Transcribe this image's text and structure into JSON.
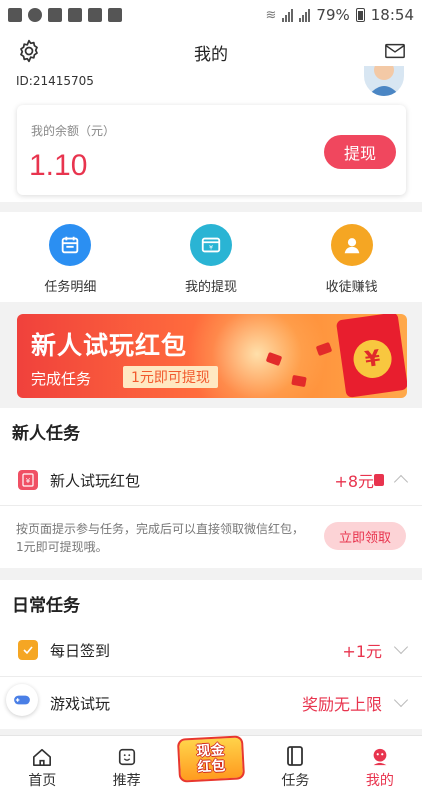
{
  "status_bar": {
    "battery": "79%",
    "time": "18:54"
  },
  "header": {
    "title": "我的"
  },
  "profile": {
    "user_id": "ID:21415705"
  },
  "balance": {
    "label": "我的余额（元）",
    "value": "1.10",
    "withdraw_label": "提现"
  },
  "quick_menu": [
    {
      "label": "任务明细",
      "icon": "calendar-icon",
      "color": "#2b8ff2"
    },
    {
      "label": "我的提现",
      "icon": "wallet-icon",
      "color": "#2ab4d4"
    },
    {
      "label": "收徒赚钱",
      "icon": "person-icon",
      "color": "#f5a623"
    }
  ],
  "banner": {
    "title": "新人试玩红包",
    "subtitle": "完成任务",
    "pill": "1元即可提现",
    "yen": "¥"
  },
  "new_tasks": {
    "section_title": "新人任务",
    "task_name": "新人试玩红包",
    "reward": "+8元",
    "description": "按页面提示参与任务，完成后可以直接领取微信红包，1元即可提现哦。",
    "claim_label": "立即领取"
  },
  "daily_tasks": {
    "section_title": "日常任务",
    "items": [
      {
        "name": "每日签到",
        "reward": "+1元"
      },
      {
        "name": "游戏试玩",
        "reward": "奖励无上限"
      }
    ]
  },
  "tabbar": {
    "items": [
      {
        "label": "首页"
      },
      {
        "label": "推荐"
      },
      {
        "label": "任务"
      },
      {
        "label": "我的"
      }
    ],
    "center_badge_top": "现金",
    "center_badge_bottom": "红包"
  },
  "colors": {
    "accent": "#e8344e",
    "button": "#f0475e"
  }
}
